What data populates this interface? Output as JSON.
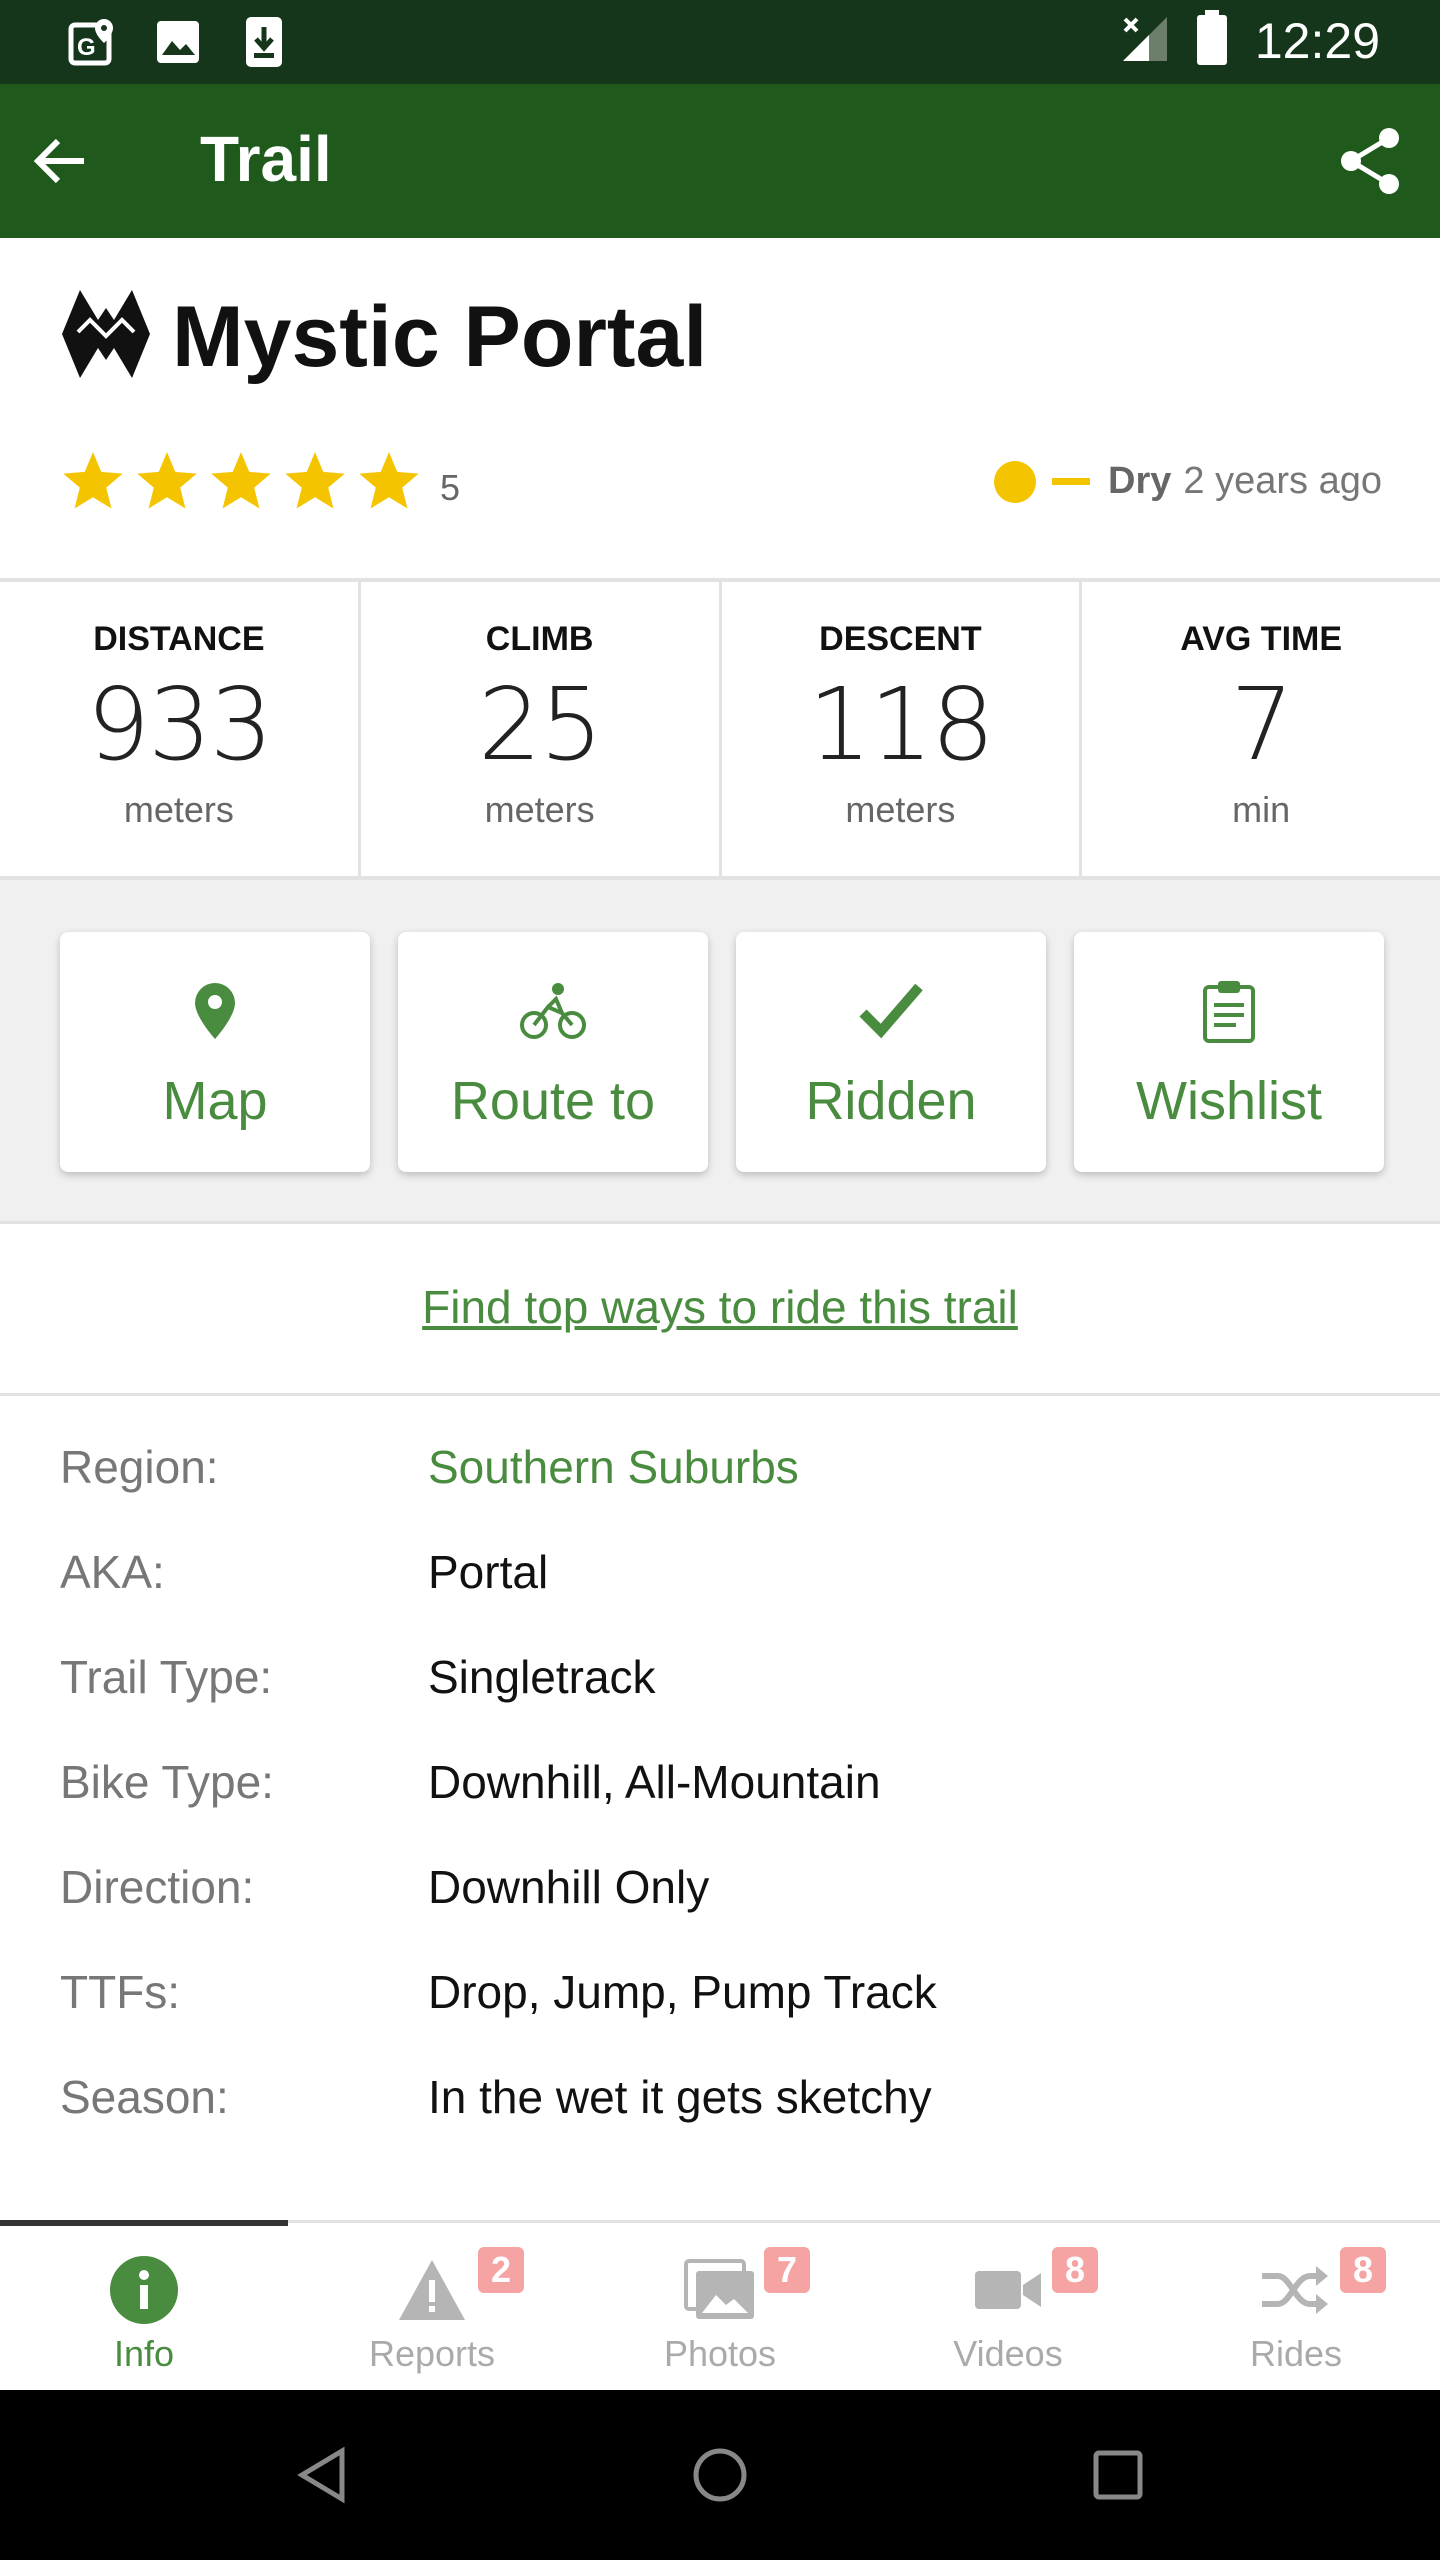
{
  "status_bar": {
    "time": "12:29",
    "left_icons": [
      "maps-icon",
      "image-icon",
      "download-icon"
    ],
    "right_icons": [
      "signal-icon",
      "battery-icon"
    ]
  },
  "app_bar": {
    "title": "Trail"
  },
  "trail": {
    "name": "Mystic Portal",
    "rating_stars": 5,
    "rating_text": "5",
    "condition_label": "Dry",
    "condition_time": "2 years ago",
    "condition_color": "#f5c400"
  },
  "stats": [
    {
      "label": "DISTANCE",
      "value": "933",
      "unit": "meters"
    },
    {
      "label": "CLIMB",
      "value": "25",
      "unit": "meters"
    },
    {
      "label": "DESCENT",
      "value": "118",
      "unit": "meters"
    },
    {
      "label": "AVG TIME",
      "value": "7",
      "unit": "min"
    }
  ],
  "actions": [
    {
      "label": "Map",
      "icon": "map-pin-icon"
    },
    {
      "label": "Route to",
      "icon": "bike-icon"
    },
    {
      "label": "Ridden",
      "icon": "check-icon"
    },
    {
      "label": "Wishlist",
      "icon": "clipboard-icon"
    }
  ],
  "find_link": "Find top ways to ride this trail",
  "details": [
    {
      "key": "Region:",
      "value": "Southern Suburbs"
    },
    {
      "key": "AKA:",
      "value": "Portal"
    },
    {
      "key": "Trail Type:",
      "value": "Singletrack"
    },
    {
      "key": "Bike Type:",
      "value": "Downhill, All-Mountain"
    },
    {
      "key": "Direction:",
      "value": "Downhill Only"
    },
    {
      "key": "TTFs:",
      "value": "Drop, Jump, Pump Track"
    },
    {
      "key": "Season:",
      "value": "In the wet it gets sketchy"
    }
  ],
  "tabs": [
    {
      "label": "Info",
      "badge": "",
      "icon": "info-icon",
      "active": true
    },
    {
      "label": "Reports",
      "badge": "2",
      "icon": "warning-icon",
      "active": false
    },
    {
      "label": "Photos",
      "badge": "7",
      "icon": "photos-icon",
      "active": false
    },
    {
      "label": "Videos",
      "badge": "8",
      "icon": "video-camera-icon",
      "active": false
    },
    {
      "label": "Rides",
      "badge": "8",
      "icon": "shuffle-icon",
      "active": false
    }
  ],
  "colors": {
    "status_bar": "#15361a",
    "app_bar": "#1f5a1c",
    "accent_green": "#4a8c3f",
    "star_yellow": "#f5c400",
    "badge_pink": "#f5a3a3"
  }
}
